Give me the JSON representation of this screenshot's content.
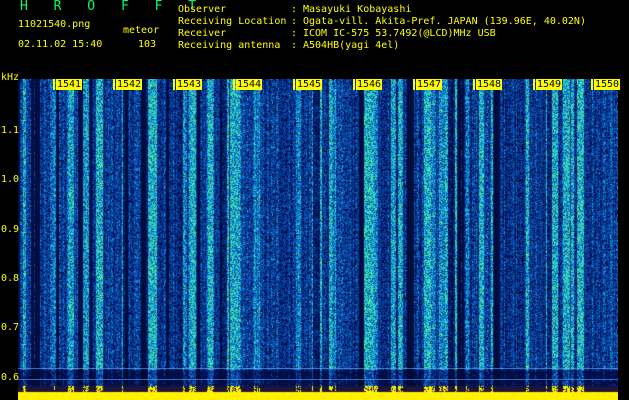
{
  "header": {
    "brand": "H R O F F T",
    "file_name": "11021540.png",
    "meteor_label": "meteor",
    "capture_time": "02.11.02 15:40",
    "meteor_count": "103",
    "rows": [
      {
        "key": "Observer",
        "value": "Masayuki Kobayashi"
      },
      {
        "key": "Receiving Location",
        "value": "Ogata-vill. Akita-Pref. JAPAN (139.96E, 40.02N)"
      },
      {
        "key": "Receiver",
        "value": "ICOM IC-575 53.7492(@LCD)MHz USB"
      },
      {
        "key": "Receiving antenna",
        "value": "A504HB(yagi 4el)"
      }
    ],
    "colon": ":"
  },
  "axis": {
    "y_unit": "kHz",
    "y_ticks": [
      "1.1",
      "1.0",
      "0.9",
      "0.8",
      "0.7",
      "0.6"
    ],
    "time_ticks": [
      "1541",
      "1542",
      "1543",
      "1544",
      "1545",
      "1546",
      "1547",
      "1548",
      "1549",
      "1550"
    ]
  },
  "colors": {
    "background": "#000000",
    "text": "#ffff00",
    "brand": "#00ff66",
    "spectrogram_base": "#0a1a6e",
    "spectrogram_mid": "#1f7fd6",
    "spectrogram_hot": "#21d38a"
  }
}
